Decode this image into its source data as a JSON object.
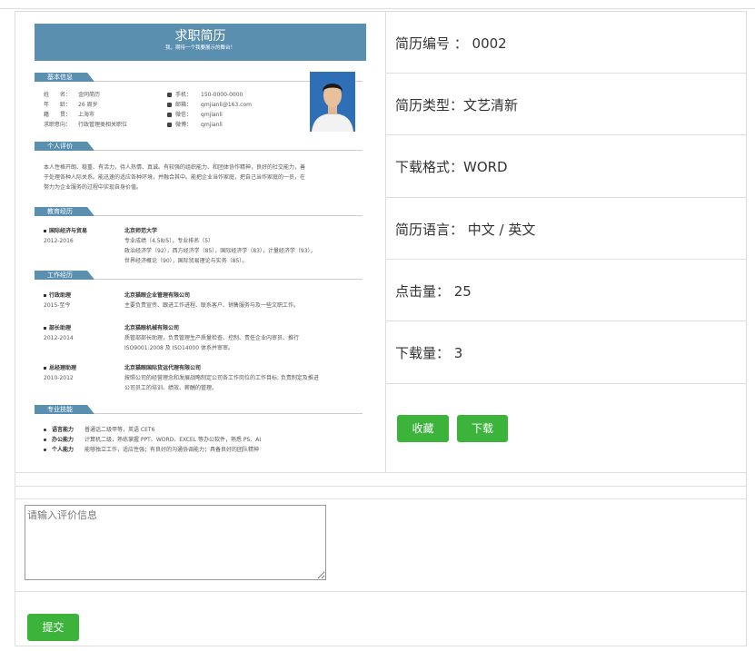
{
  "resume_preview": {
    "title": "求职简历",
    "subtitle": "我，期待一个我要展示的舞台！",
    "sections": {
      "basic": "基本信息",
      "evaluation": "个人评价",
      "education": "教育经历",
      "work": "工作经历",
      "skills": "专业技能"
    },
    "basic_left": [
      {
        "label": "姓　　名：",
        "value": "金同简历"
      },
      {
        "label": "年　　龄：",
        "value": "26 周岁"
      },
      {
        "label": "籍　　贯：",
        "value": "上海市"
      },
      {
        "label": "求职意向：",
        "value": "行政管理类相关职位"
      }
    ],
    "basic_right": [
      {
        "label": "手机：",
        "value": "150-0000-0000"
      },
      {
        "label": "邮箱：",
        "value": "qmjianli@163.com"
      },
      {
        "label": "微信：",
        "value": "qmjianli"
      },
      {
        "label": "微博：",
        "value": "qmjianli"
      }
    ],
    "evaluation_lines": [
      "本人性格开朗、稳重、有活力，待人热情、真诚。有较强的组织能力、和团体协作精神，良好的社交能力，善",
      "于处理各种人际关系。能迅速的适应各种环境，并融合其中。能把企业当作家庭，把自己当作家庭的一员，在",
      "努力为企业服务的过程中实现自身价值。"
    ],
    "education": {
      "major": "国际经济与贸易",
      "period": "2012-2016",
      "school": "北京师范大学",
      "lines": [
        "专业成绩（4.58/5），专业排名（5）",
        "政治经济学（92），西方经济学（85），国际经济学（83），计量经济学（93），",
        "世界经济概论（90），国际贸易理论与实务（85）。"
      ]
    },
    "work": [
      {
        "role": "行政助理",
        "period": "2015-至今",
        "company": "北京猫眼企业管理有限公司",
        "lines": [
          "主要负责宣传、跟进工作进程、联系客户、销售服务与及一些文职工作。"
        ]
      },
      {
        "role": "部长助理",
        "period": "2012-2014",
        "company": "北京猫眼机械有限公司",
        "lines": [
          "质管部部长助理，负责管理生产质量检查、控制、责任企业内审员、推行",
          "ISO9001:2008 及 ISO14000 体系并审审。"
        ]
      },
      {
        "role": "总经理助理",
        "period": "2010-2012",
        "company": "北京猫眼国际货运代理有限公司",
        "lines": [
          "按照公司的经营理念和发展战略制定公司各工作岗位的工作目标; 负责制定及推进",
          "公司员工的培训、绩效、薪酬的管理。"
        ]
      }
    ],
    "skills": [
      {
        "label": "语言能力",
        "value": "普通话二级甲等，英语 CET6"
      },
      {
        "label": "办公能力",
        "value": "计算机二级，熟练掌握 PPT、WORD、EXCEL 等办公软件，熟悉 PS、AI"
      },
      {
        "label": "个人能力",
        "value": "能够独立工作，适应性强；有良好的沟通协调能力；具备良好的团队精神"
      }
    ]
  },
  "info": {
    "id": "简历编号 ： 0002",
    "type": "简历类型：文艺清新",
    "format": "下载格式：WORD",
    "language": "简历语言： 中文 / 英文",
    "clicks": "点击量： 25",
    "downloads": "下载量： 3"
  },
  "actions": {
    "favorite": "收藏",
    "download": "下载"
  },
  "comment": {
    "placeholder": "请输入评价信息",
    "submit": "提交"
  },
  "colors": {
    "accent": "#3cb43c",
    "resume_theme": "#5b8fb0"
  }
}
